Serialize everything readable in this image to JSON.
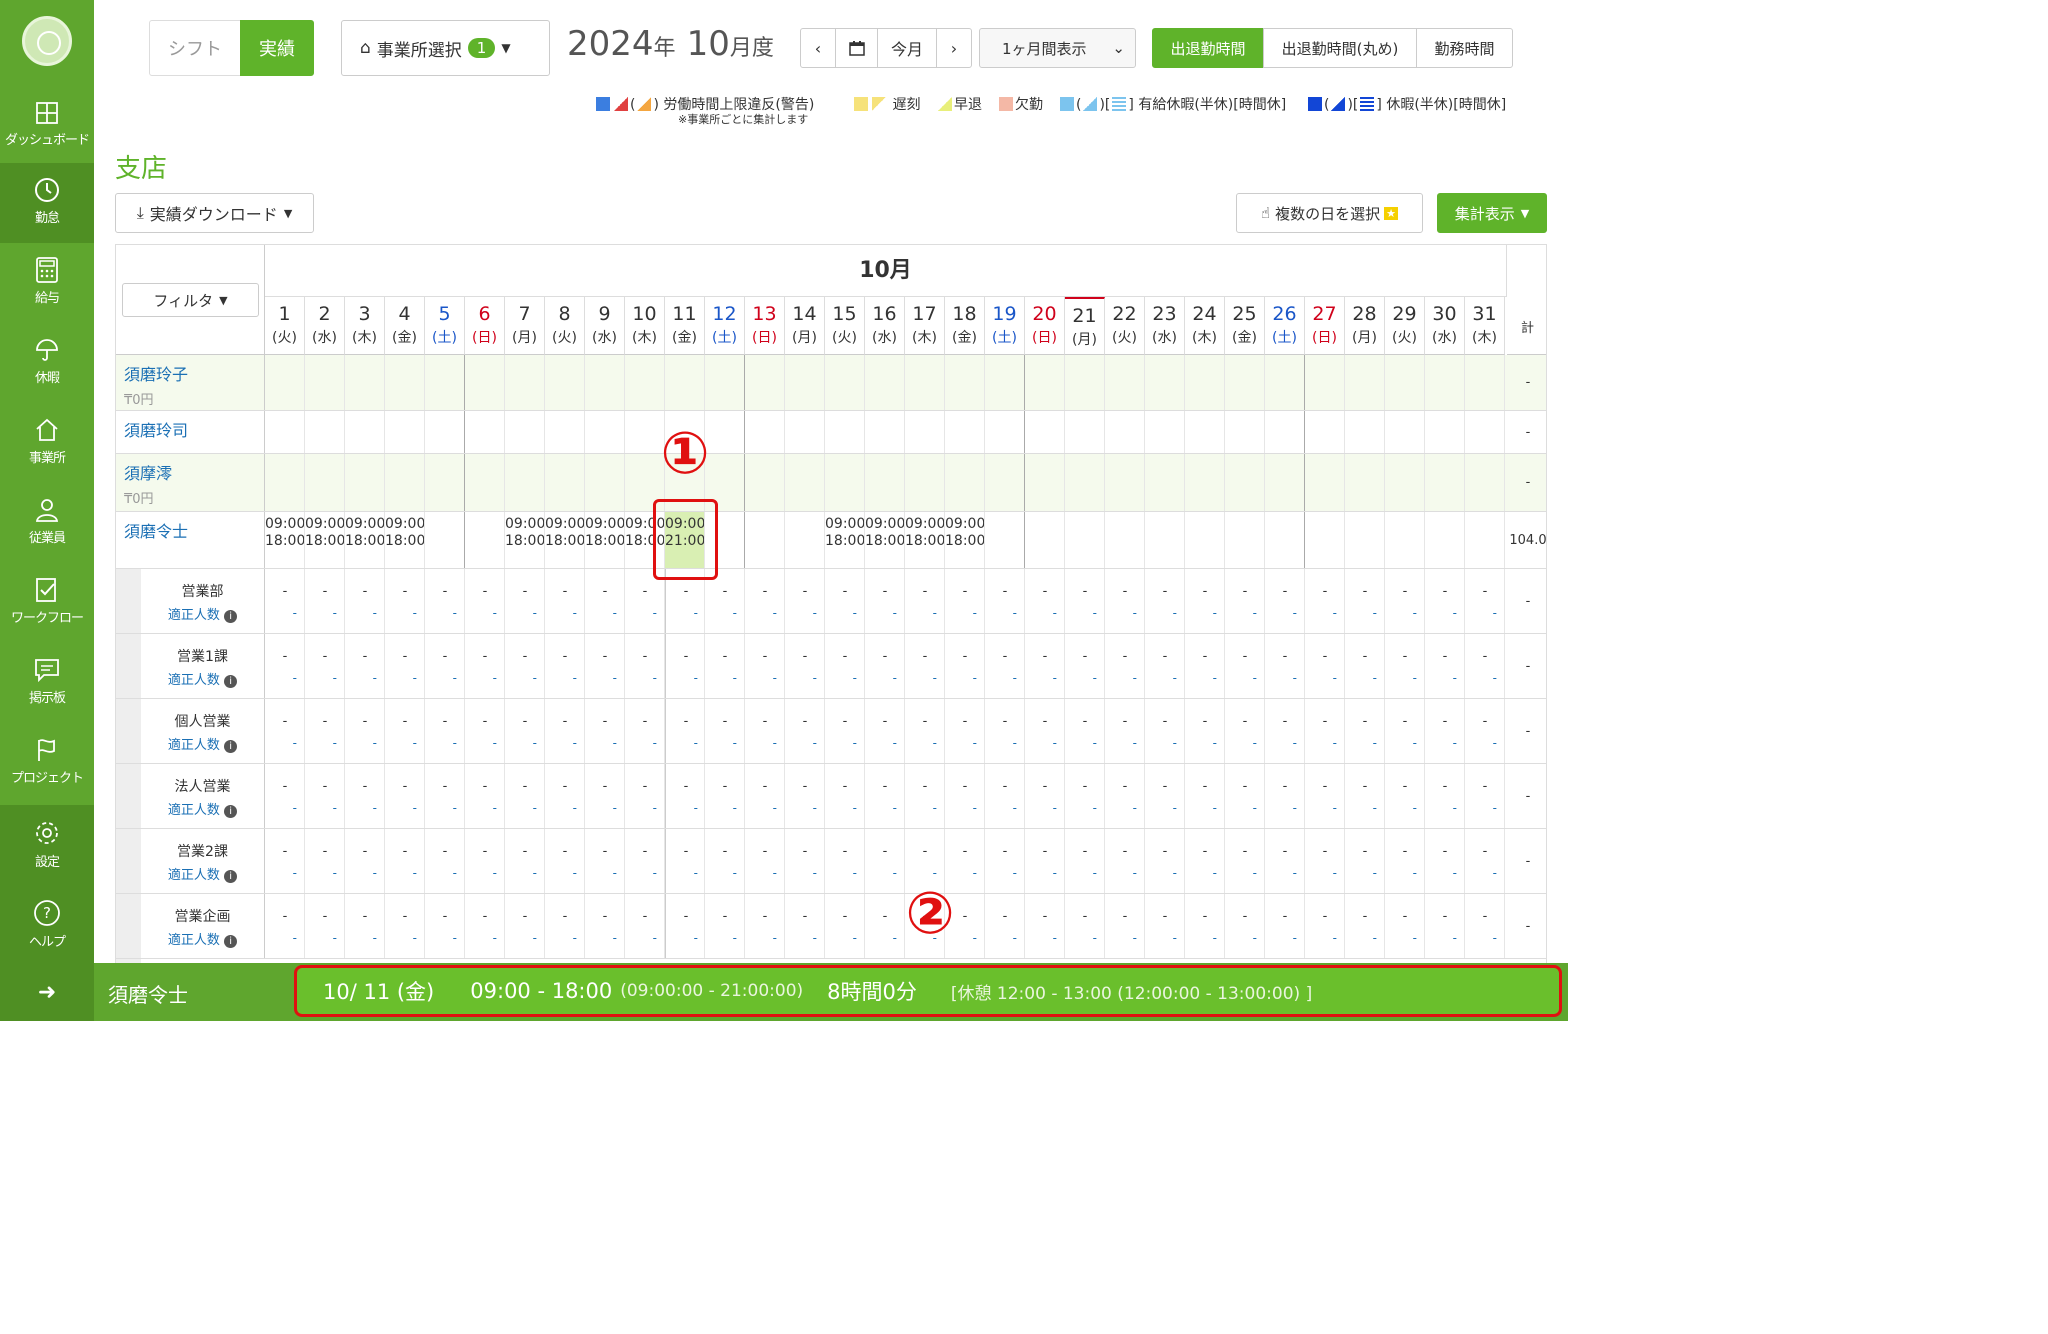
{
  "sidebar": {
    "items": [
      {
        "label": "ダッシュボード",
        "icon": "dashboard-icon"
      },
      {
        "label": "勤怠",
        "icon": "clock-icon"
      },
      {
        "label": "給与",
        "icon": "calculator-icon"
      },
      {
        "label": "休暇",
        "icon": "umbrella-icon"
      },
      {
        "label": "事業所",
        "icon": "home-icon"
      },
      {
        "label": "従業員",
        "icon": "person-icon"
      },
      {
        "label": "ワークフロー",
        "icon": "checklist-icon"
      },
      {
        "label": "掲示板",
        "icon": "chat-icon"
      },
      {
        "label": "プロジェクト",
        "icon": "flag-icon"
      },
      {
        "label": "設定",
        "icon": "gear-icon"
      },
      {
        "label": "ヘルプ",
        "icon": "help-icon"
      }
    ],
    "expand": "➜"
  },
  "toolbar": {
    "mode_shift": "シフト",
    "mode_actual": "実績",
    "office_select": "事業所選択",
    "office_count": "1",
    "year": "2024",
    "year_suffix": "年",
    "month": "10",
    "month_suffix": "月度",
    "prev": "‹",
    "today": "今月",
    "next": "›",
    "range": "1ヶ月間表示",
    "view_tabs": [
      "出退勤時間",
      "出退勤時間(丸め)",
      "勤務時間"
    ]
  },
  "legend": {
    "overtime": "労働時間上限違反(警告)",
    "overtime_note": "※事業所ごとに集計します",
    "late": "遅刻",
    "early": "早退",
    "absent": "欠勤",
    "paid_leave": "有給休暇(半休)[時間休]",
    "leave": "休暇(半休)[時間休]",
    "colors": {
      "late": "#f6e27a",
      "early": "#e8ef7a",
      "absent": "#f4b8a6",
      "paid": "#7cc4ee",
      "leave": "#1246d6",
      "warn": "#e04040"
    }
  },
  "page": {
    "title": "支店",
    "download": "実績ダウンロード",
    "multi_select": "複数の日を選択",
    "summary": "集計表示"
  },
  "table": {
    "month_label": "10月",
    "filter": "フィルタ",
    "total_header": "計",
    "days": [
      {
        "n": "1",
        "w": "(火)"
      },
      {
        "n": "2",
        "w": "(水)"
      },
      {
        "n": "3",
        "w": "(木)"
      },
      {
        "n": "4",
        "w": "(金)"
      },
      {
        "n": "5",
        "w": "(土)"
      },
      {
        "n": "6",
        "w": "(日)"
      },
      {
        "n": "7",
        "w": "(月)"
      },
      {
        "n": "8",
        "w": "(火)"
      },
      {
        "n": "9",
        "w": "(水)"
      },
      {
        "n": "10",
        "w": "(木)"
      },
      {
        "n": "11",
        "w": "(金)"
      },
      {
        "n": "12",
        "w": "(土)"
      },
      {
        "n": "13",
        "w": "(日)"
      },
      {
        "n": "14",
        "w": "(月)"
      },
      {
        "n": "15",
        "w": "(火)"
      },
      {
        "n": "16",
        "w": "(水)"
      },
      {
        "n": "17",
        "w": "(木)"
      },
      {
        "n": "18",
        "w": "(金)"
      },
      {
        "n": "19",
        "w": "(土)"
      },
      {
        "n": "20",
        "w": "(日)"
      },
      {
        "n": "21",
        "w": "(月)"
      },
      {
        "n": "22",
        "w": "(火)"
      },
      {
        "n": "23",
        "w": "(水)"
      },
      {
        "n": "24",
        "w": "(木)"
      },
      {
        "n": "25",
        "w": "(金)"
      },
      {
        "n": "26",
        "w": "(土)"
      },
      {
        "n": "27",
        "w": "(日)"
      },
      {
        "n": "28",
        "w": "(月)"
      },
      {
        "n": "29",
        "w": "(火)"
      },
      {
        "n": "30",
        "w": "(水)"
      },
      {
        "n": "31",
        "w": "(木)"
      }
    ],
    "employees": [
      {
        "name": "須磨玲子",
        "yen": "₸0円",
        "total": "-"
      },
      {
        "name": "須磨玲司",
        "yen": "",
        "total": "-"
      },
      {
        "name": "須摩澪",
        "yen": "₸0円",
        "total": "-"
      },
      {
        "name": "須磨令士",
        "yen": "",
        "total": "104.0"
      }
    ],
    "shifts": {
      "1": [
        "09:00",
        "18:00"
      ],
      "2": [
        "09:00",
        "18:00"
      ],
      "3": [
        "09:00",
        "18:00"
      ],
      "4": [
        "09:00",
        "18:00"
      ],
      "7": [
        "09:00",
        "18:00"
      ],
      "8": [
        "09:00",
        "18:00"
      ],
      "9": [
        "09:00",
        "18:00"
      ],
      "10": [
        "09:00",
        "18:00"
      ],
      "11": [
        "09:00",
        "21:00"
      ],
      "15": [
        "09:00",
        "18:00"
      ],
      "16": [
        "09:00",
        "18:00"
      ],
      "17": [
        "09:00",
        "18:00"
      ],
      "18": [
        "09:00",
        "18:00"
      ]
    },
    "departments": [
      {
        "name": "営業部",
        "sub": "適正人数"
      },
      {
        "name": "営業1課",
        "sub": "適正人数"
      },
      {
        "name": "個人営業",
        "sub": "適正人数"
      },
      {
        "name": "法人営業",
        "sub": "適正人数"
      },
      {
        "name": "営業2課",
        "sub": "適正人数"
      },
      {
        "name": "営業企画",
        "sub": "適正人数"
      }
    ],
    "dash": "-"
  },
  "annotations": {
    "one": "①",
    "two": "②"
  },
  "footer": {
    "employee": "須磨令士",
    "date": "10/ 11 (金)",
    "time": "09:00 - 18:00",
    "time_actual": "(09:00:00 - 21:00:00)",
    "duration": "8時間0分",
    "break": "[休憩 12:00 - 13:00 (12:00:00 - 13:00:00) ]"
  }
}
